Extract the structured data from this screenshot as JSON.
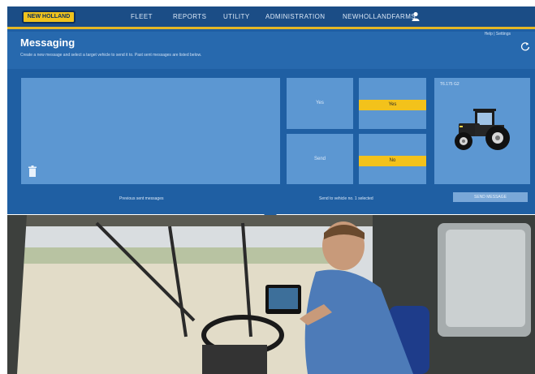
{
  "nav": {
    "brand": "NEW HOLLAND",
    "items": [
      "FLEET",
      "REPORTS",
      "UTILITY",
      "ADMINISTRATION",
      "NEWHOLLANDFARMS"
    ]
  },
  "page": {
    "title": "Messaging",
    "subtitle": "Create a new message and select a target vehicle to send it to. Past sent messages are listed below.",
    "help": "Help | Settings"
  },
  "actions": {
    "label_1": "Yes",
    "label_2": "Send",
    "yes_button": "Yes",
    "no_button": "No",
    "tractor_label": "T6.175 G2"
  },
  "footer": {
    "left_text": "Previous sent messages",
    "mid_text": "Send to vehicle no. 1 selected",
    "button": "SEND MESSAGE"
  },
  "colors": {
    "accent": "#f3c21b",
    "brand_blue": "#1f5fa3"
  }
}
